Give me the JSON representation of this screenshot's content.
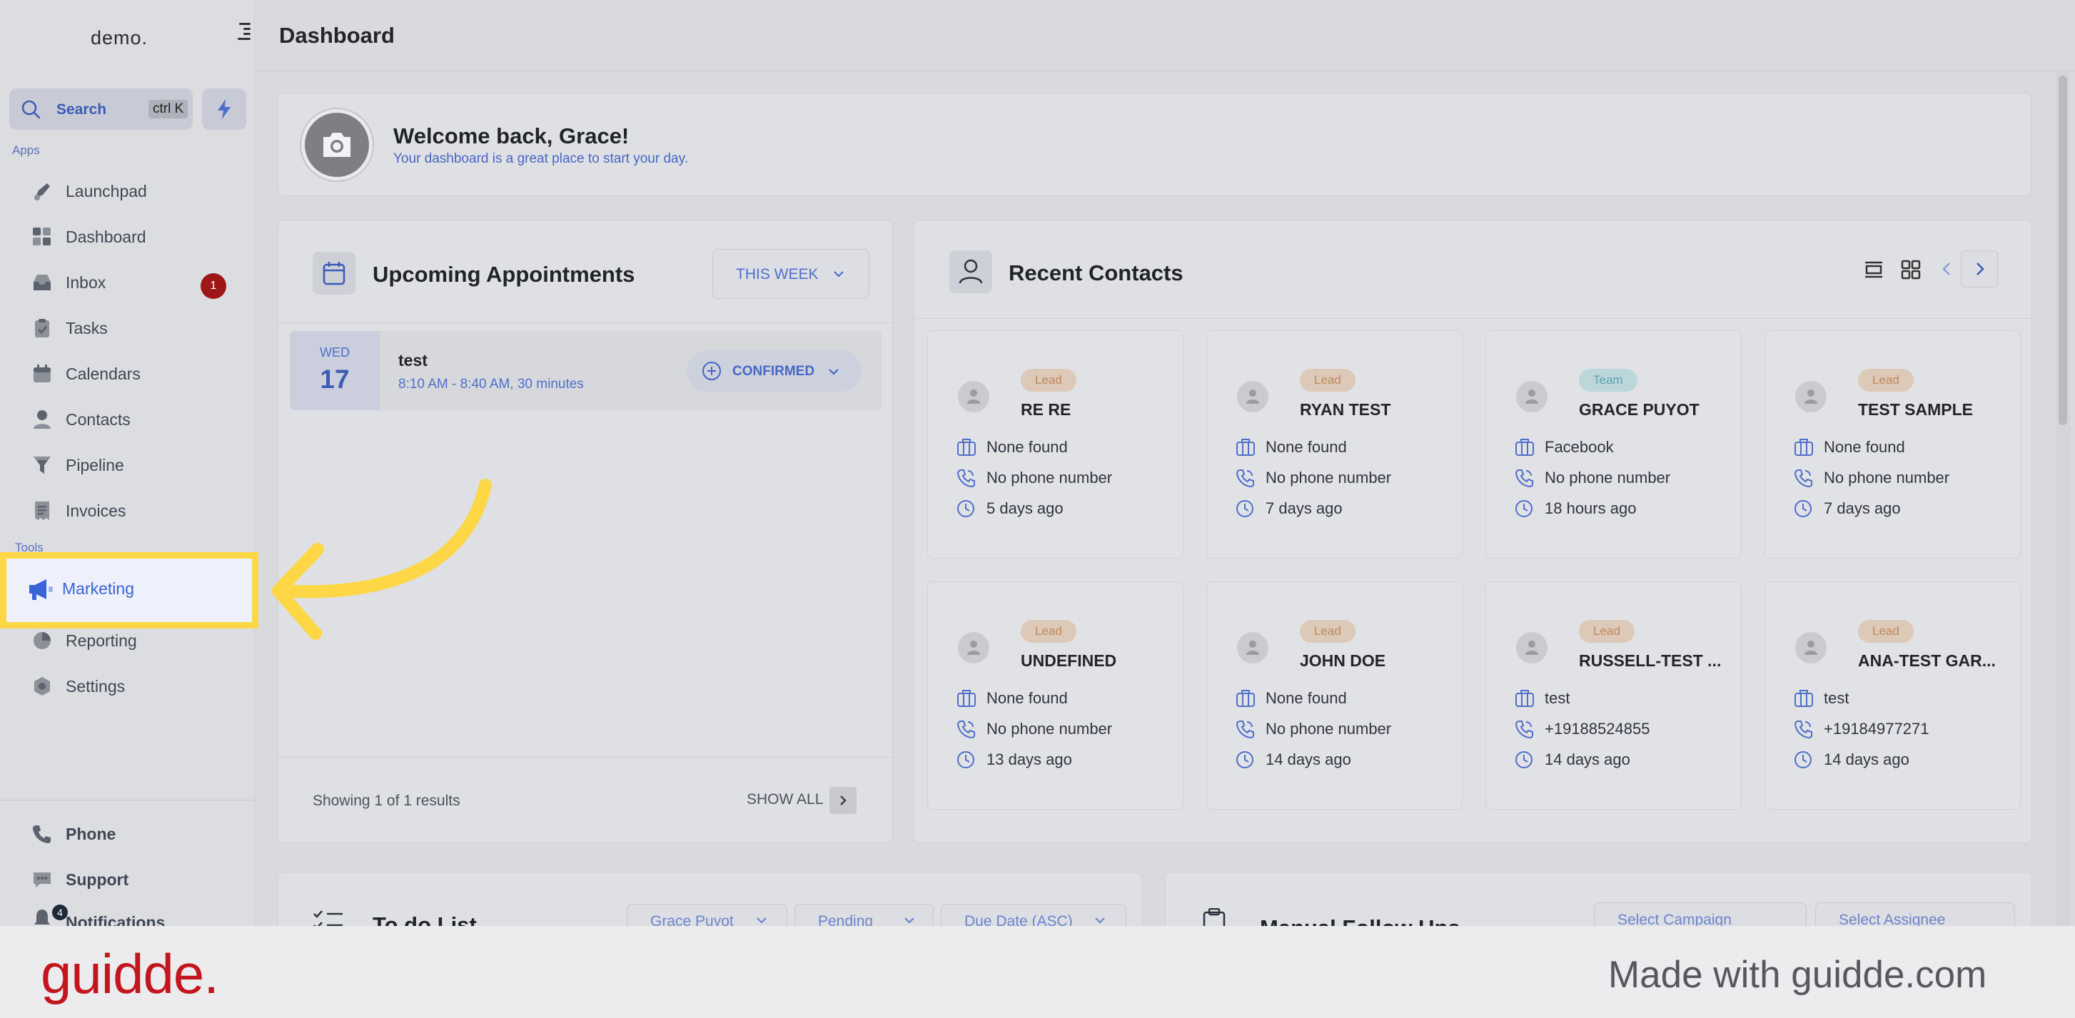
{
  "sidebar": {
    "logo": "demo.",
    "search_label": "Search",
    "search_shortcut": "ctrl K",
    "apps_label": "Apps",
    "tools_label": "Tools",
    "items": [
      {
        "label": "Launchpad"
      },
      {
        "label": "Dashboard"
      },
      {
        "label": "Inbox",
        "badge": "1"
      },
      {
        "label": "Tasks"
      },
      {
        "label": "Calendars"
      },
      {
        "label": "Contacts"
      },
      {
        "label": "Pipeline"
      },
      {
        "label": "Invoices"
      }
    ],
    "tools": [
      {
        "label": "Marketing"
      },
      {
        "label": "Reporting"
      },
      {
        "label": "Settings"
      }
    ],
    "bottom": [
      {
        "label": "Phone"
      },
      {
        "label": "Support"
      },
      {
        "label": "Notifications",
        "badge": "4"
      }
    ]
  },
  "header": {
    "title": "Dashboard"
  },
  "welcome": {
    "heading": "Welcome back, Grace!",
    "subheading": "Your dashboard is a great place to start your day."
  },
  "appointments": {
    "title": "Upcoming Appointments",
    "range": "THIS WEEK",
    "items": [
      {
        "dow": "WED",
        "day": "17",
        "name": "test",
        "time": "8:10 AM - 8:40 AM, 30 minutes",
        "status": "CONFIRMED"
      }
    ],
    "footer": "Showing 1 of 1 results",
    "show_all": "SHOW ALL"
  },
  "contacts": {
    "title": "Recent Contacts",
    "items": [
      {
        "tag": "Lead",
        "name": "RE RE",
        "source": "None found",
        "phone": "No phone number",
        "time": "5 days ago"
      },
      {
        "tag": "Lead",
        "name": "RYAN TEST",
        "source": "None found",
        "phone": "No phone number",
        "time": "7 days ago"
      },
      {
        "tag": "Team",
        "name": "GRACE PUYOT",
        "source": "Facebook",
        "phone": "No phone number",
        "time": "18 hours ago"
      },
      {
        "tag": "Lead",
        "name": "TEST SAMPLE",
        "source": "None found",
        "phone": "No phone number",
        "time": "7 days ago"
      },
      {
        "tag": "Lead",
        "name": "UNDEFINED",
        "source": "None found",
        "phone": "No phone number",
        "time": "13 days ago"
      },
      {
        "tag": "Lead",
        "name": "JOHN DOE",
        "source": "None found",
        "phone": "No phone number",
        "time": "14 days ago"
      },
      {
        "tag": "Lead",
        "name": "RUSSELL-TEST ...",
        "source": "test",
        "phone": "+19188524855",
        "time": "14 days ago"
      },
      {
        "tag": "Lead",
        "name": "ANA-TEST GAR...",
        "source": "test",
        "phone": "+19184977271",
        "time": "14 days ago"
      }
    ]
  },
  "todo": {
    "title": "To do List",
    "filters": [
      "Grace Puyot",
      "Pending",
      "Due Date (ASC)"
    ]
  },
  "followups": {
    "title": "Manual Follow Ups",
    "filters": [
      "Select Campaign",
      "Select Assignee"
    ]
  },
  "footer": {
    "brand": "guidde.",
    "made_with": "Made with guidde.com"
  },
  "colors": {
    "accent": "#3a63d6",
    "highlight": "#fdd745",
    "brand_red": "#c3151d",
    "badge_red": "#9d1717"
  }
}
